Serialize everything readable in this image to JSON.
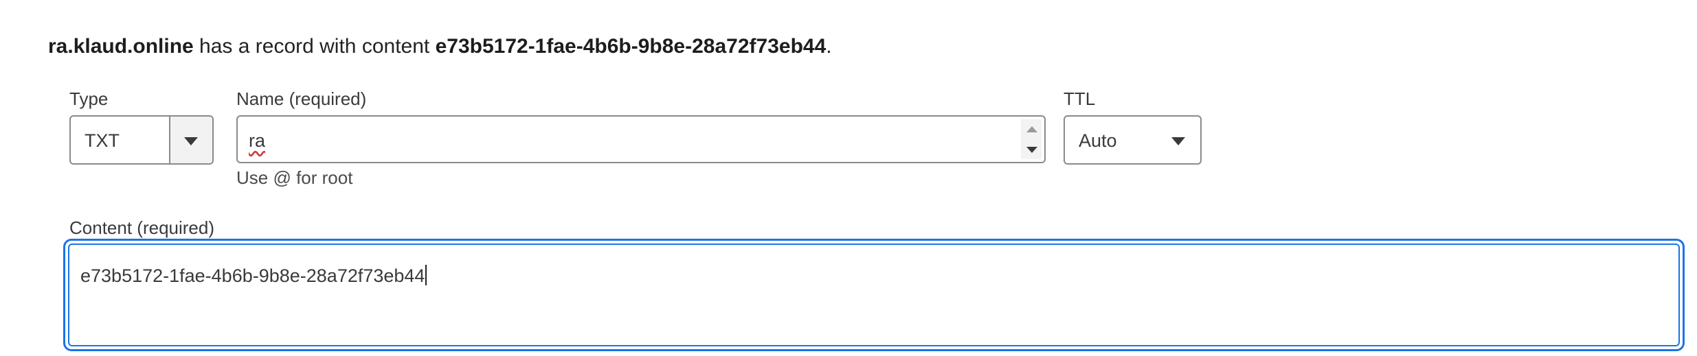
{
  "summary": {
    "name": "ra.klaud.online",
    "middle": " has a record with content ",
    "content": "e73b5172-1fae-4b6b-9b8e-28a72f73eb44",
    "end": "."
  },
  "type_field": {
    "label": "Type",
    "value": "TXT",
    "icon": "chevron-down-icon"
  },
  "name_field": {
    "label": "Name (required)",
    "value": "ra",
    "hint": "Use @ for root"
  },
  "ttl_field": {
    "label": "TTL",
    "value": "Auto",
    "icon": "chevron-down-icon"
  },
  "content_field": {
    "label": "Content (required)",
    "value": "e73b5172-1fae-4b6b-9b8e-28a72f73eb44",
    "focused": true
  },
  "colors": {
    "focus_accent": "#1a73e8",
    "border": "#8a8a8a",
    "spellcheck": "#d23b3b"
  }
}
